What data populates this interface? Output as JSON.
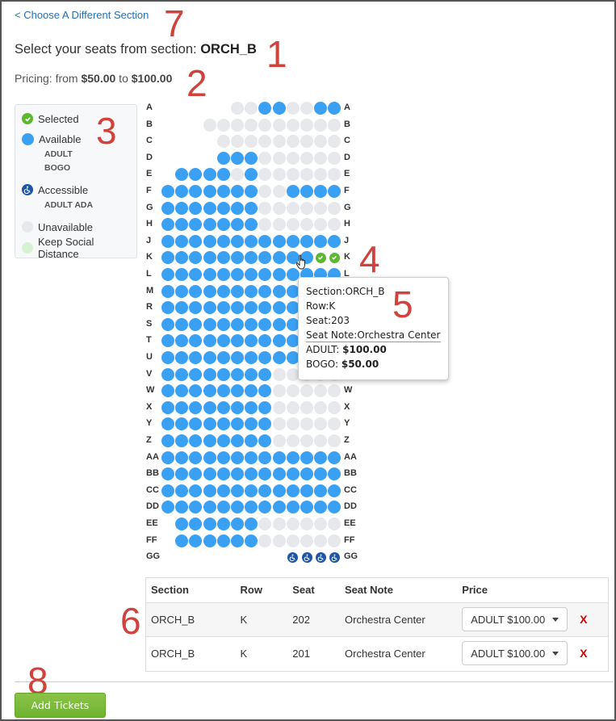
{
  "header": {
    "back_link": "< Choose A Different Section",
    "title_prefix": "Select your seats from section: ",
    "section": "ORCH_B",
    "pricing_prefix": "Pricing: from ",
    "price_min": "$50.00",
    "pricing_mid": " to ",
    "price_max": "$100.00"
  },
  "annotations": [
    "1",
    "2",
    "3",
    "4",
    "5",
    "6",
    "7",
    "8"
  ],
  "legend": {
    "selected": "Selected",
    "available": "Available",
    "available_types": [
      "ADULT",
      "BOGO"
    ],
    "accessible": "Accessible",
    "accessible_types": [
      "ADULT ADA"
    ],
    "unavailable": "Unavailable",
    "distance": "Keep Social Distance"
  },
  "colors": {
    "available": "#3aa0f3",
    "unavailable": "#e6e8eb",
    "selected": "#5cb82f",
    "accessible": "#1d55a8",
    "distance": "#d7f2d3",
    "link": "#2a6fb0",
    "remove": "#d40000",
    "add_button": "#7cbb3a"
  },
  "seatmap": {
    "legend_codes": {
      "a": "available",
      "u": "unavailable",
      "s": "selected",
      "h": "accessible",
      ".": "empty"
    },
    "rows": [
      {
        "label": "A",
        "seats": ".....uuaauuaa"
      },
      {
        "label": "B",
        "seats": "...uuuuuuuuuu"
      },
      {
        "label": "C",
        "seats": "....uuuuuuuuu"
      },
      {
        "label": "D",
        "seats": "....aaauuuuuu"
      },
      {
        "label": "E",
        "seats": ".aaaauauuuuuu"
      },
      {
        "label": "F",
        "seats": "aaaaaaauuaaaa"
      },
      {
        "label": "G",
        "seats": "aaaaaaauuuuuu"
      },
      {
        "label": "H",
        "seats": "aaaaaaauuuuuu"
      },
      {
        "label": "J",
        "seats": "aaaaaaaaaaaaa"
      },
      {
        "label": "K",
        "seats": "aaaaaaaaaaass"
      },
      {
        "label": "L",
        "seats": "aaaaaaaaaaaaa"
      },
      {
        "label": "M",
        "seats": "aaaaaaaaaaaaa"
      },
      {
        "label": "R",
        "seats": "aaaaaaaaaaaaa"
      },
      {
        "label": "S",
        "seats": "aaaaaaaaaaaaa"
      },
      {
        "label": "T",
        "seats": "aaaaaaaaaaaaa"
      },
      {
        "label": "U",
        "seats": "aaaaaaaaaaaaa"
      },
      {
        "label": "V",
        "seats": "aaaaaaaauuuuu"
      },
      {
        "label": "W",
        "seats": "aaaaaaaauuuuu"
      },
      {
        "label": "X",
        "seats": "aaaaaaaauuuuu"
      },
      {
        "label": "Y",
        "seats": "aaaaaaaauuuuu"
      },
      {
        "label": "Z",
        "seats": "aaaaaaaauuuuu"
      },
      {
        "label": "AA",
        "seats": "aaaaaaaaaaaaa"
      },
      {
        "label": "BB",
        "seats": "aaaaaaaaaaaaa"
      },
      {
        "label": "CC",
        "seats": "aaaaaaaaaaaaa"
      },
      {
        "label": "DD",
        "seats": "aaaaaaaaaaaaa"
      },
      {
        "label": "EE",
        "seats": ".aaaaaauuuuuu"
      },
      {
        "label": "FF",
        "seats": ".aaaaaauuuuuu"
      },
      {
        "label": "GG",
        "seats": ".........hhhh"
      }
    ]
  },
  "tooltip": {
    "section": "Section:ORCH_B",
    "row": "Row:K",
    "seat": "Seat:203",
    "note": "Seat Note:Orchestra Center",
    "adult_label": "ADULT: ",
    "adult_price": "$100.00",
    "bogo_label": "BOGO: ",
    "bogo_price": "$50.00"
  },
  "cart": {
    "headers": [
      "Section",
      "Row",
      "Seat",
      "Seat Note",
      "Price",
      ""
    ],
    "rows": [
      {
        "section": "ORCH_B",
        "row": "K",
        "seat": "202",
        "note": "Orchestra Center",
        "price": "ADULT $100.00",
        "remove": "X"
      },
      {
        "section": "ORCH_B",
        "row": "K",
        "seat": "201",
        "note": "Orchestra Center",
        "price": "ADULT $100.00",
        "remove": "X"
      }
    ]
  },
  "footer": {
    "add_button": "Add Tickets"
  }
}
